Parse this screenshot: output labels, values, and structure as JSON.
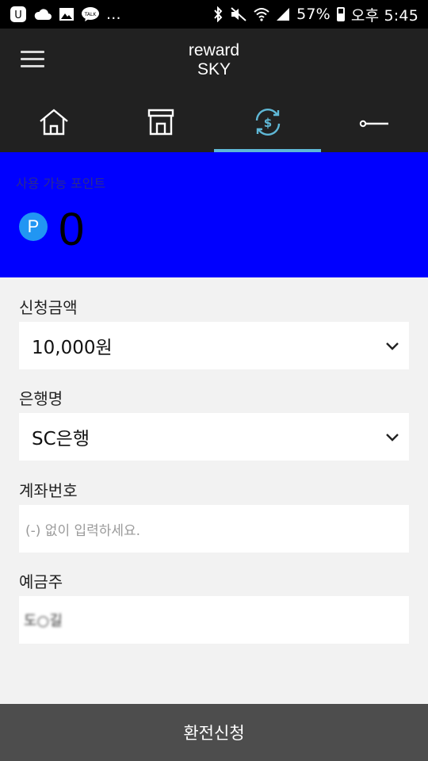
{
  "status_bar": {
    "notification_more": "...",
    "battery": "57%",
    "time": "오후 5:45",
    "icons": [
      "u-plus-icon",
      "cloud-icon",
      "gallery-icon",
      "kakaotalk-icon",
      "bluetooth-icon",
      "mute-icon",
      "wifi-icon",
      "signal-icon",
      "battery-icon"
    ]
  },
  "app": {
    "title_line1": "reward",
    "title_line2": "SKY"
  },
  "tabs": [
    {
      "icon": "home-icon"
    },
    {
      "icon": "store-icon"
    },
    {
      "icon": "exchange-icon",
      "active": true
    },
    {
      "icon": "key-icon"
    }
  ],
  "points": {
    "label": "사용 가능 포인트",
    "badge": "P",
    "value": "0"
  },
  "form": {
    "amount_label": "신청금액",
    "amount_value": "10,000원",
    "bank_label": "은행명",
    "bank_value": "SC은행",
    "account_label": "계좌번호",
    "account_placeholder": "(-) 없이 입력하세요.",
    "holder_label": "예금주",
    "holder_value": "도○길"
  },
  "submit_label": "환전신청",
  "colors": {
    "status_bar": "#000000",
    "app_bar": "#212121",
    "tab_indicator": "#5fb8d6",
    "points_bg": "#0000ff",
    "p_badge": "#2196f3",
    "form_bg": "#f2f2f2",
    "submit_bg": "#4d4d4d"
  }
}
